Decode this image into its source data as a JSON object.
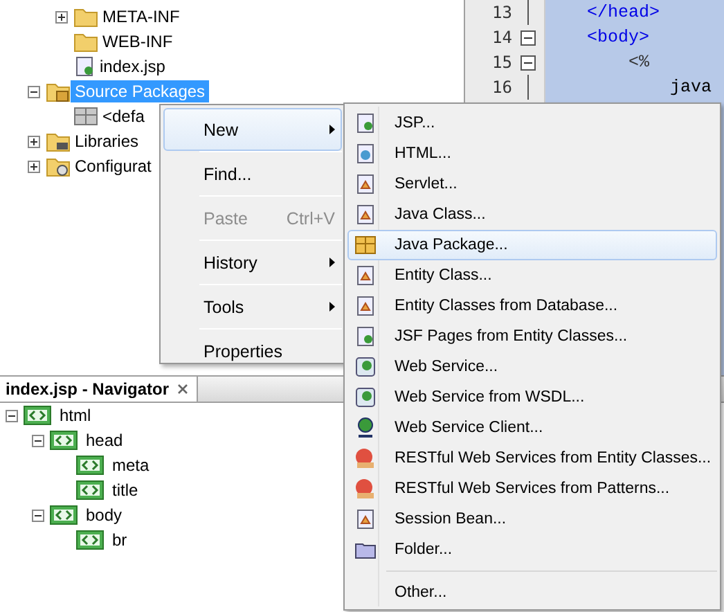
{
  "project_tree": [
    {
      "children": [
        {
          "label": "META-INF",
          "kind": "folder",
          "expanded": false
        },
        {
          "label": "WEB-INF",
          "kind": "folder"
        },
        {
          "label": "index.jsp",
          "kind": "jsp"
        }
      ]
    },
    {
      "label": "Source Packages",
      "kind": "sources",
      "expanded": true,
      "selected": true,
      "children": [
        {
          "label": "<defa",
          "kind": "package"
        }
      ]
    },
    {
      "label": "Libraries",
      "kind": "libraries",
      "expanded": false
    },
    {
      "label": "Configurat",
      "kind": "config",
      "expanded": false
    }
  ],
  "editor": {
    "lines": [
      {
        "number": "13",
        "foldable": false,
        "code": "    </head>",
        "kind": "tag"
      },
      {
        "number": "14",
        "foldable": true,
        "code": "    <body>",
        "kind": "tag"
      },
      {
        "number": "15",
        "foldable": true,
        "code": "        <%",
        "kind": "scriptlet"
      },
      {
        "number": "16",
        "foldable": false,
        "code": "            java",
        "kind": "plain"
      }
    ]
  },
  "navigator": {
    "title": "index.jsp - Navigator",
    "tree": [
      {
        "label": "html",
        "expanded": true,
        "children": [
          {
            "label": "head",
            "expanded": true,
            "children": [
              {
                "label": "meta"
              },
              {
                "label": "title"
              }
            ]
          },
          {
            "label": "body",
            "expanded": true,
            "children": [
              {
                "label": "br"
              }
            ]
          }
        ]
      }
    ]
  },
  "context_menu": [
    {
      "label": "New",
      "submenu": true,
      "selected": true,
      "disabled": false
    },
    {
      "label": "Find...",
      "submenu": false,
      "selected": false,
      "disabled": false
    },
    {
      "label": "Paste",
      "shortcut": "Ctrl+V",
      "submenu": false,
      "selected": false,
      "disabled": true
    },
    {
      "label": "History",
      "submenu": true,
      "selected": false,
      "disabled": false
    },
    {
      "label": "Tools",
      "submenu": true,
      "selected": false,
      "disabled": false
    },
    {
      "label": "Properties",
      "submenu": false,
      "selected": false,
      "disabled": false
    }
  ],
  "submenu": [
    {
      "label": "JSP...",
      "kind": "jsp",
      "selected": false
    },
    {
      "label": "HTML...",
      "kind": "html",
      "selected": false
    },
    {
      "label": "Servlet...",
      "kind": "class",
      "selected": false
    },
    {
      "label": "Java Class...",
      "kind": "class",
      "selected": false
    },
    {
      "label": "Java Package...",
      "kind": "package",
      "selected": true
    },
    {
      "label": "Entity Class...",
      "kind": "class",
      "selected": false
    },
    {
      "label": "Entity Classes from Database...",
      "kind": "class",
      "selected": false
    },
    {
      "label": "JSF Pages from Entity Classes...",
      "kind": "jsp",
      "selected": false
    },
    {
      "label": "Web Service...",
      "kind": "webservice",
      "selected": false
    },
    {
      "label": "Web Service from WSDL...",
      "kind": "webservice",
      "selected": false
    },
    {
      "label": "Web Service Client...",
      "kind": "client",
      "selected": false
    },
    {
      "label": "RESTful Web Services from Entity Classes...",
      "kind": "rest",
      "selected": false
    },
    {
      "label": "RESTful Web Services from Patterns...",
      "kind": "rest",
      "selected": false
    },
    {
      "label": "Session Bean...",
      "kind": "class",
      "selected": false
    },
    {
      "label": "Folder...",
      "kind": "folder",
      "selected": false
    },
    {
      "label": "Other...",
      "kind": "other",
      "selected": false,
      "separator_before": true
    }
  ]
}
